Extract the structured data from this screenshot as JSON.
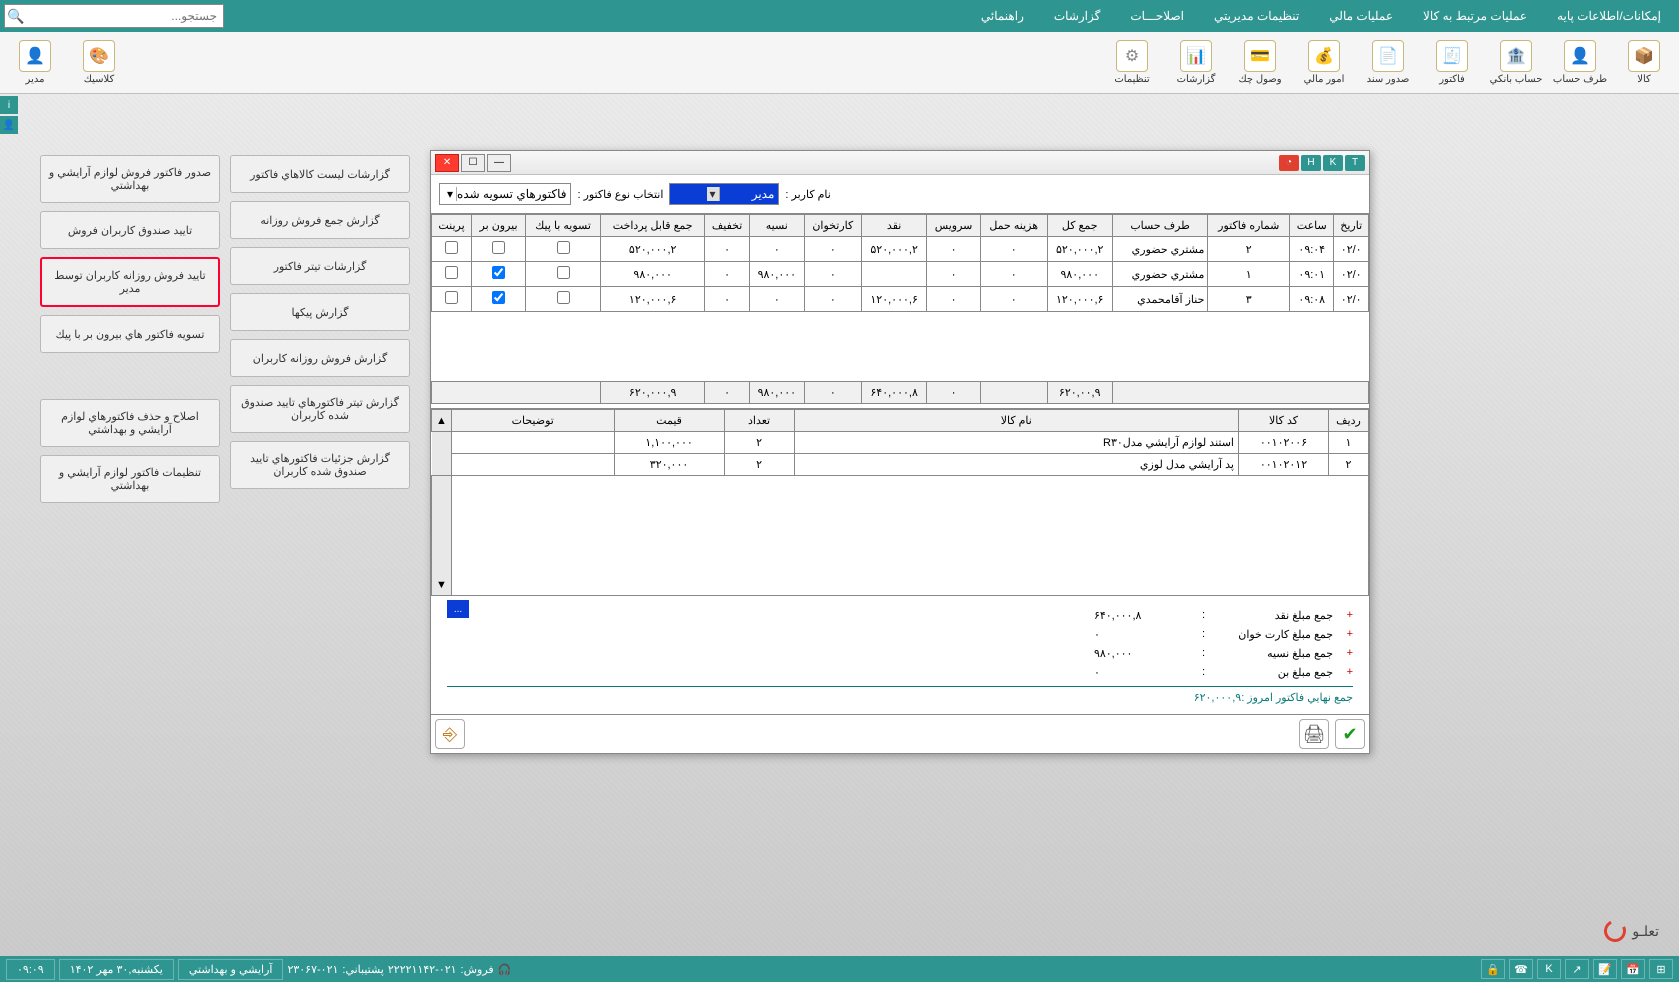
{
  "menu": {
    "items": [
      "إمكانات/اطلاعات پايه",
      "عمليات مرتبط به كالا",
      "عمليات مالي",
      "تنظيمات مديريتي",
      "اصلاحـــات",
      "گزارشات",
      "راهنمائي"
    ],
    "search_placeholder": "جستجو..."
  },
  "toolbar": {
    "right": [
      {
        "label": "كالا"
      },
      {
        "label": "طرف حساب"
      },
      {
        "label": "حساب بانكي"
      },
      {
        "label": "فاكتور"
      },
      {
        "label": "صدور سند"
      },
      {
        "label": "امور مالي"
      },
      {
        "label": "وصول چك"
      },
      {
        "label": "گزارشات"
      },
      {
        "label": "تنظيمات"
      }
    ],
    "left": [
      {
        "label": "كلاسيك"
      },
      {
        "label": "مدير"
      }
    ]
  },
  "side_left_col": [
    "گزارشات ليست كالاهاي فاكتور",
    "گزارش جمع فروش روزانه",
    "گزارشات تيتر فاكتور",
    "گزارش پيكها",
    "گزارش فروش روزانه كاربران",
    "گزارش تيتر فاكتورهاي تاييد صندوق شده كاربران",
    "گزارش جزئيات فاكتورهاي تاييد صندوق شده كاربران"
  ],
  "side_right_col": [
    "صدور فاكتور فروش لوازم آرايشي و بهداشتي",
    "تاييد صندوق كاربران فروش",
    "تاييد فروش روزانه كاربران توسط مدير",
    "تسويه فاكتور هاي بيرون بر با پيك",
    "اصلاح و حذف فاكتورهاي لوازم آرايشي و بهداشتي",
    "تنظيمات فاكتور لوازم آرايشي و بهداشتي"
  ],
  "side_highlighted_index": 2,
  "window": {
    "badges": [
      "T",
      "K",
      "H"
    ],
    "filter": {
      "user_label": "نام كاربر :",
      "user_value": "مدير",
      "type_label": "انتخاب نوع فاكتور :",
      "type_value": "فاكتورهاي تسويه شده"
    },
    "grid1": {
      "headers": [
        "تاريخ",
        "ساعت",
        "شماره فاكتور",
        "طرف حساب",
        "جمع كل",
        "هزينه حمل",
        "سرويس",
        "نقد",
        "كارتخوان",
        "نسيه",
        "تخفيف",
        "جمع قابل پرداخت",
        "تسويه با پيك",
        "بيرون بر",
        "پرينت"
      ],
      "rows": [
        {
          "date": "٠٢/٠",
          "time": "٠٩:٠۴",
          "no": "٢",
          "account": "مشتري حضوري",
          "total": "٢,۵٢٠,٠٠٠",
          "ship": "٠",
          "service": "٠",
          "cash": "٢,۵٢٠,٠٠٠",
          "card": "٠",
          "credit": "٠",
          "discount": "٠",
          "payable": "٢,۵٢٠,٠٠٠",
          "peyk": false,
          "out": false,
          "print": false
        },
        {
          "date": "٠٢/٠",
          "time": "٠٩:٠١",
          "no": "١",
          "account": "مشتري حضوري",
          "total": "٩٨٠,٠٠٠",
          "ship": "٠",
          "service": "٠",
          "cash": "",
          "card": "٠",
          "credit": "٩٨٠,٠٠٠",
          "discount": "٠",
          "payable": "٩٨٠,٠٠٠",
          "peyk": false,
          "out": true,
          "print": false
        },
        {
          "date": "٠٢/٠",
          "time": "٠٩:٠٨",
          "no": "٣",
          "account": "حناز آقامحمدي",
          "total": "۶,١٢٠,٠٠٠",
          "ship": "٠",
          "service": "٠",
          "cash": "۶,١٢٠,٠٠٠",
          "card": "٠",
          "credit": "٠",
          "discount": "٠",
          "payable": "۶,١٢٠,٠٠٠",
          "peyk": false,
          "out": true,
          "print": false
        }
      ],
      "sums": {
        "total": "٩,۶٢٠,٠٠",
        "ship": "",
        "service": "٠",
        "cash": "٨,۶۴٠,٠٠٠",
        "card": "٠",
        "credit": "٩٨٠,٠٠٠",
        "discount": "٠",
        "payable": "٩,۶٢٠,٠٠٠"
      }
    },
    "grid2": {
      "headers": [
        "رديف",
        "كد كالا",
        "نام كالا",
        "تعداد",
        "قيمت",
        "توضيحات"
      ],
      "rows": [
        {
          "idx": "١",
          "code": "٠٠١٠٢٠٠۶",
          "name": "استند لوازم آرايشي مدلR٣٠",
          "qty": "٢",
          "price": "١,١٠٠,٠٠٠",
          "note": ""
        },
        {
          "idx": "٢",
          "code": "٠٠١٠٢٠١٢",
          "name": "پد آرايشي مدل لوزي",
          "qty": "٢",
          "price": "٣٢٠,٠٠٠",
          "note": ""
        }
      ]
    },
    "summary": {
      "rows": [
        {
          "label": "جمع مبلغ نقد",
          "val": "٨,۶۴٠,٠٠٠"
        },
        {
          "label": "جمع مبلغ كارت خوان",
          "val": "٠"
        },
        {
          "label": "جمع مبلغ نسيه",
          "val": "٩٨٠,٠٠٠"
        },
        {
          "label": "جمع مبلغ بن",
          "val": "٠"
        }
      ],
      "total_label": "جمع نهايي فاكتور امروز :",
      "total_val": "٩,۶٢٠,٠٠٠"
    }
  },
  "brand": "تعلـو",
  "status": {
    "sales_label": "فروش:",
    "sales_phone": "٠٢١-٢٢٢٢١١۴٢",
    "support_label": "پشتيباني:",
    "support_phone": "٠٢١-٢٣٠۶٧",
    "shop": "آرايشي و بهداشتي",
    "date": "يكشنبه,٣٠ مهر ١۴٠٢",
    "time": "٠٩:٠٩"
  }
}
